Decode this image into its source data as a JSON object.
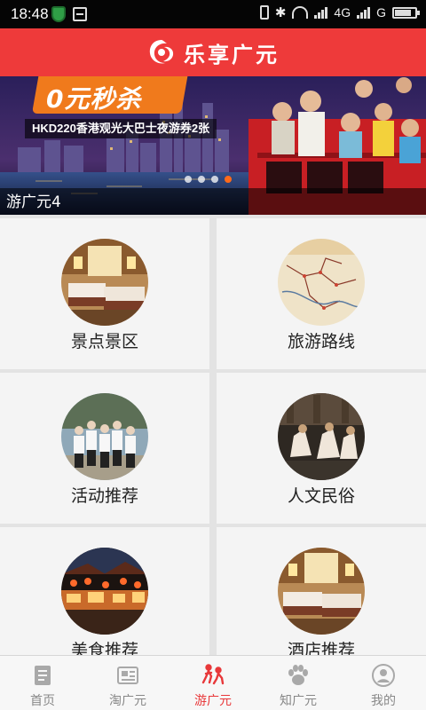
{
  "status_bar": {
    "time": "18:48",
    "network_label": "4G",
    "carrier_label": "G"
  },
  "header": {
    "title": "乐享广元",
    "brand_color": "#ee3a3a"
  },
  "banner": {
    "promo_text": "0元秒杀",
    "subtitle": "HKD220香港观光大巴士夜游券2张",
    "caption": "游广元4",
    "slide_count": 4,
    "active_slide": 1
  },
  "categories": [
    {
      "label": "景点景区",
      "icon": "hotel-room-photo"
    },
    {
      "label": "旅游路线",
      "icon": "travel-map-photo"
    },
    {
      "label": "活动推荐",
      "icon": "group-activity-photo"
    },
    {
      "label": "人文民俗",
      "icon": "folk-dance-photo"
    },
    {
      "label": "美食推荐",
      "icon": "night-street-photo"
    },
    {
      "label": "酒店推荐",
      "icon": "hotel-room-photo"
    }
  ],
  "bottom_nav": {
    "active_color": "#e8383a",
    "items": [
      {
        "label": "首页",
        "icon": "document-icon",
        "active": false
      },
      {
        "label": "淘广元",
        "icon": "shop-icon",
        "active": false
      },
      {
        "label": "游广元",
        "icon": "travel-icon",
        "active": true
      },
      {
        "label": "知广元",
        "icon": "paw-icon",
        "active": false
      },
      {
        "label": "我的",
        "icon": "user-icon",
        "active": false
      }
    ]
  }
}
